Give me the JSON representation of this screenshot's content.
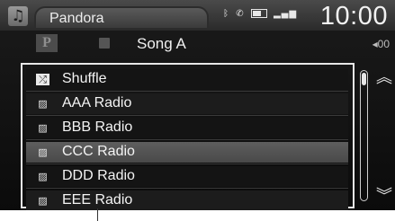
{
  "status_bar": {
    "music_icon": "music-note-icon",
    "source": "Pandora",
    "indicators": [
      "bluetooth-icon",
      "phone-icon",
      "battery-icon",
      "signal-icon"
    ],
    "time": "10:00"
  },
  "now_playing": {
    "service_icon": "pandora-logo-icon",
    "service_letter": "P",
    "art_icon": "album-art-icon",
    "song_title": "Song A",
    "elapsed": "00"
  },
  "station_list": {
    "items": [
      {
        "label": "Shuffle",
        "icon": "shuffle-icon",
        "selected": false
      },
      {
        "label": "AAA Radio",
        "icon": "station-art-icon",
        "selected": false
      },
      {
        "label": "BBB Radio",
        "icon": "station-art-icon",
        "selected": false
      },
      {
        "label": "CCC Radio",
        "icon": "station-art-icon",
        "selected": true
      },
      {
        "label": "DDD Radio",
        "icon": "station-art-icon",
        "selected": false
      },
      {
        "label": "EEE Radio",
        "icon": "station-art-icon",
        "selected": false
      }
    ],
    "scroll_up_icon": "double-chevron-up-icon",
    "scroll_down_icon": "double-chevron-down-icon",
    "scroll_position": 0
  }
}
